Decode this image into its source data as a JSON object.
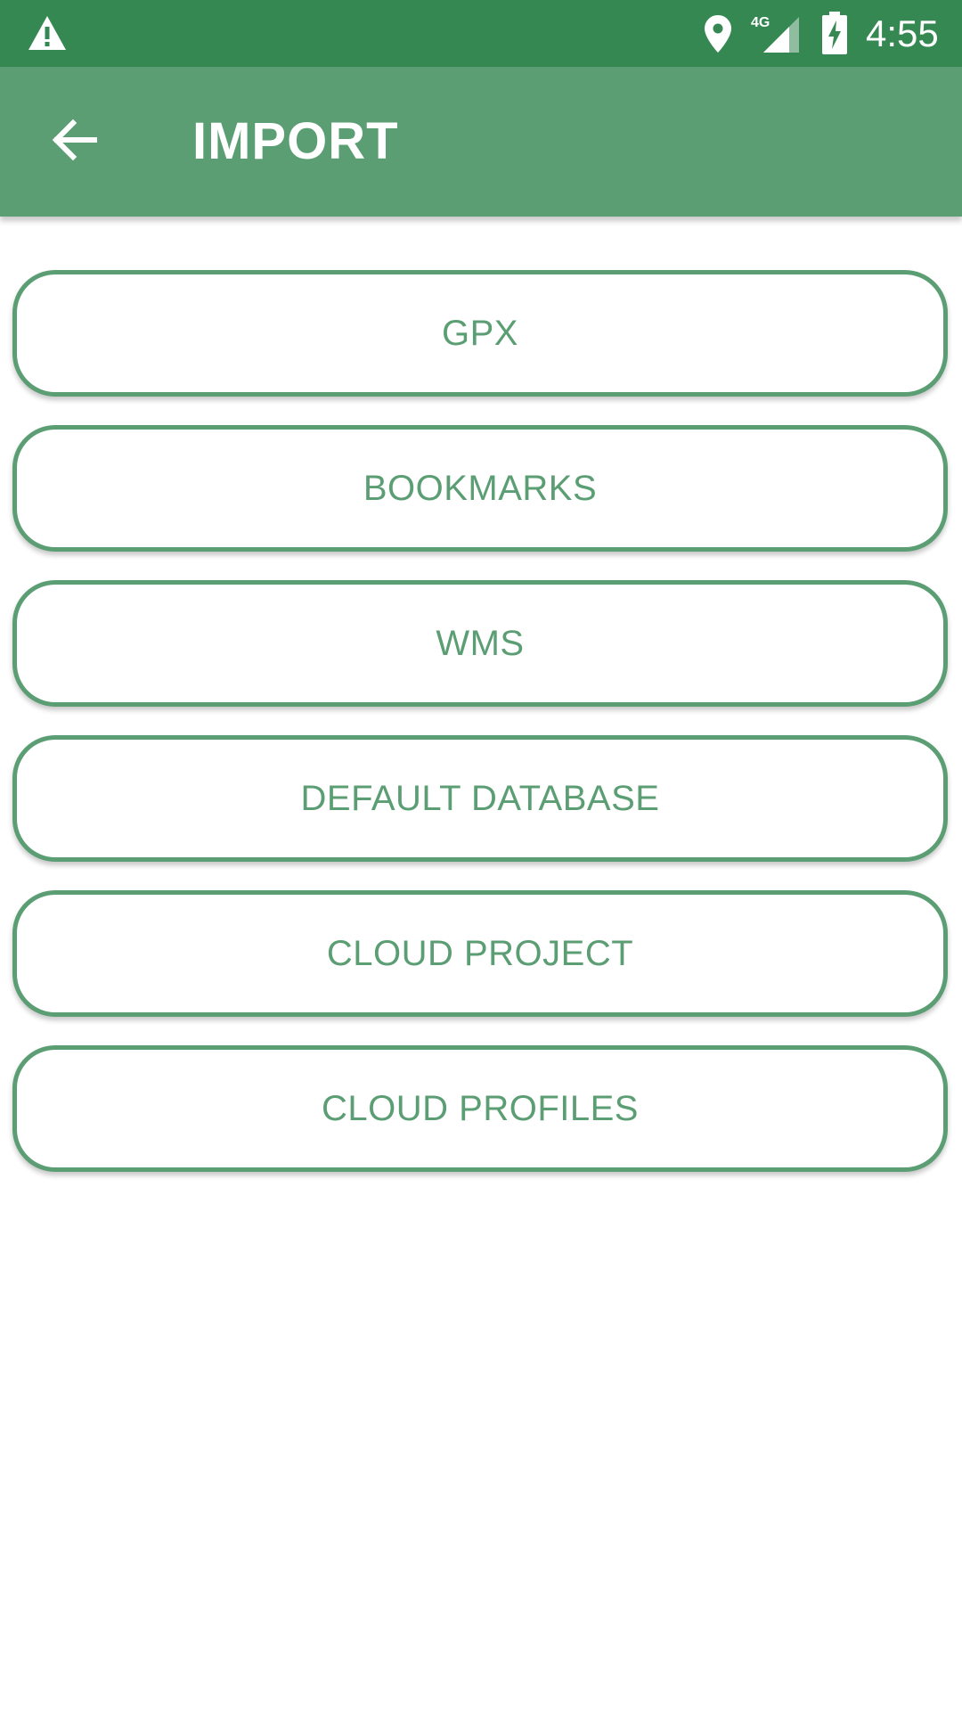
{
  "status_bar": {
    "time": "4:55",
    "network": "4G",
    "icons": [
      "warning-icon",
      "location-icon",
      "signal-icon",
      "battery-charging-icon"
    ]
  },
  "app_bar": {
    "title": "IMPORT",
    "back_icon": "arrow-back-icon"
  },
  "import_options": [
    {
      "label": "GPX"
    },
    {
      "label": "BOOKMARKS"
    },
    {
      "label": "WMS"
    },
    {
      "label": "DEFAULT DATABASE"
    },
    {
      "label": "CLOUD PROJECT"
    },
    {
      "label": "CLOUD PROFILES"
    }
  ],
  "colors": {
    "status_bar": "#368853",
    "app_bar": "#5c9e74",
    "accent": "#5c9e74",
    "background": "#ffffff"
  }
}
